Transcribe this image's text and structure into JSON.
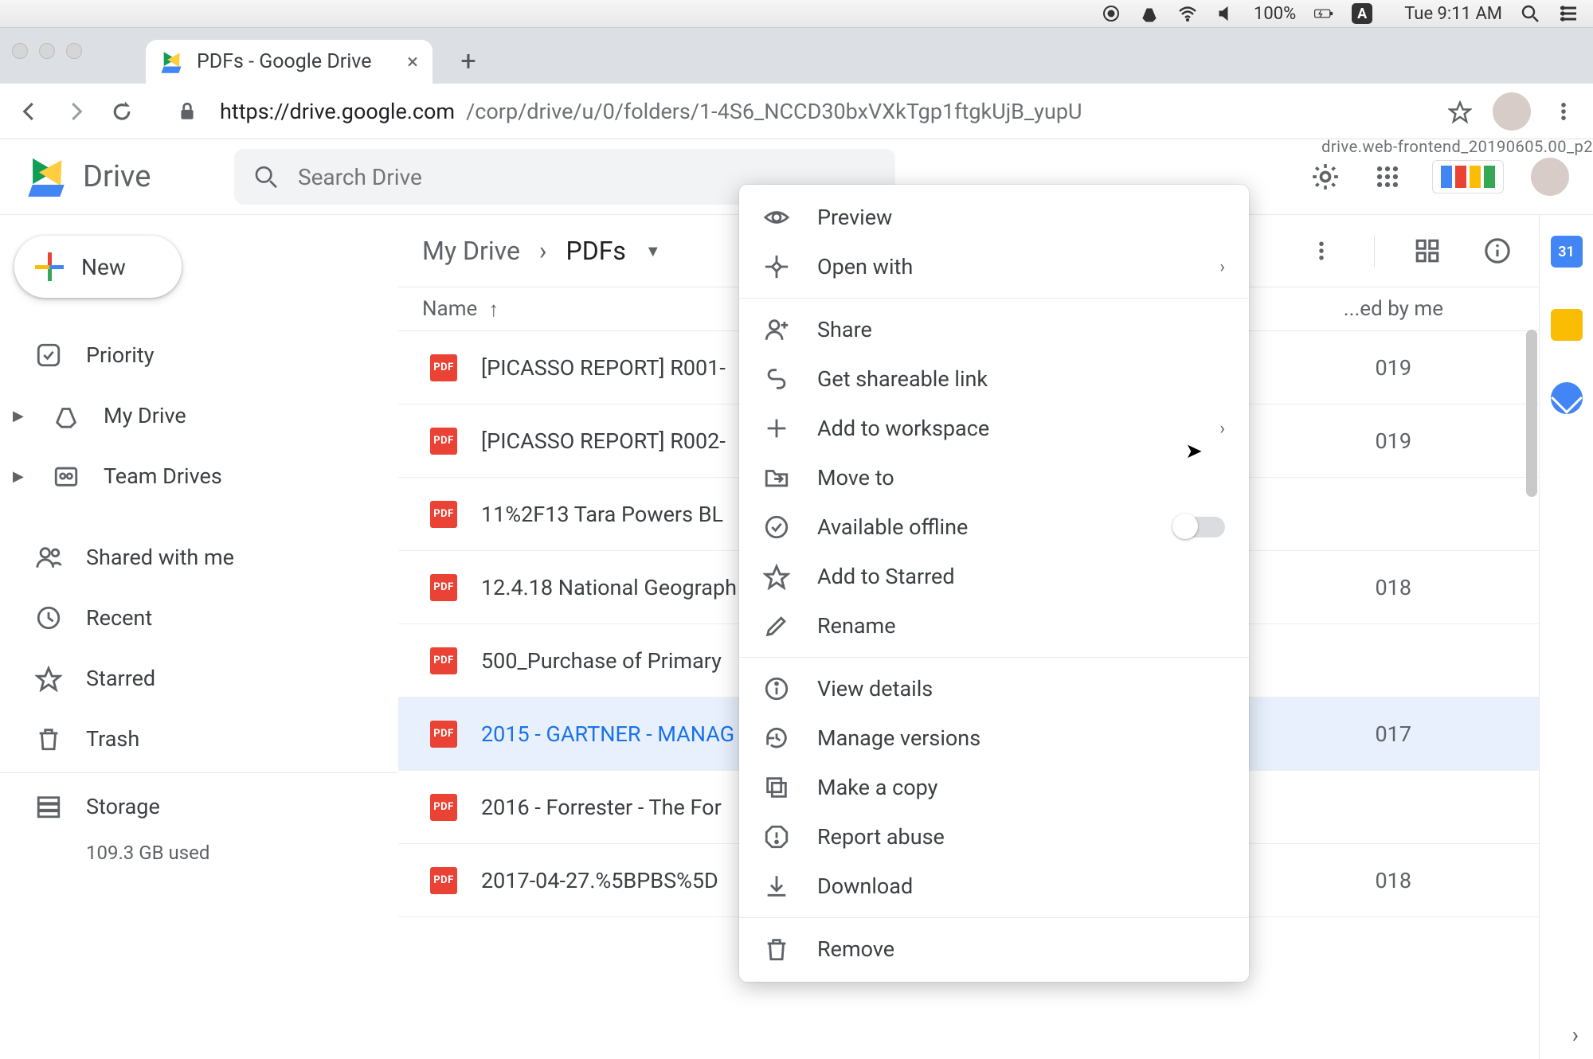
{
  "menubar": {
    "battery": "100%",
    "clock": "Tue 9:11 AM"
  },
  "tab": {
    "title": "PDFs - Google Drive"
  },
  "url": {
    "host": "https://drive.google.com",
    "path": "/corp/drive/u/0/folders/1-4S6_NCCD30bxVXkTgp1ftgkUjB_yupU"
  },
  "frontend_tag": "drive.web-frontend_20190605.00_p2",
  "drive": {
    "product": "Drive",
    "search_placeholder": "Search Drive"
  },
  "newbtn": "New",
  "sidebar": {
    "priority": "Priority",
    "mydrive": "My Drive",
    "teamdrives": "Team Drives",
    "shared": "Shared with me",
    "recent": "Recent",
    "starred": "Starred",
    "trash": "Trash",
    "storage": "Storage",
    "storage_used": "109.3 GB used"
  },
  "breadcrumb": {
    "root": "My Drive",
    "current": "PDFs"
  },
  "columns": {
    "name": "Name",
    "modified": "...ed by me"
  },
  "files": [
    {
      "name": "[PICASSO REPORT] R001-",
      "date": "019"
    },
    {
      "name": "[PICASSO REPORT] R002-",
      "date": "019"
    },
    {
      "name": "11%2F13 Tara Powers BL",
      "date": ""
    },
    {
      "name": "12.4.18 National Geograph",
      "date": "018"
    },
    {
      "name": "500_Purchase of Primary",
      "date": ""
    },
    {
      "name": "2015 - GARTNER - MANAG",
      "date": "017"
    },
    {
      "name": "2016 - Forrester - The For",
      "date": ""
    },
    {
      "name": "2017-04-27.%5BPBS%5D",
      "date": "018"
    }
  ],
  "context": {
    "preview": "Preview",
    "openwith": "Open with",
    "share": "Share",
    "getlink": "Get shareable link",
    "addworkspace": "Add to workspace",
    "moveto": "Move to",
    "offline": "Available offline",
    "star": "Add to Starred",
    "rename": "Rename",
    "details": "View details",
    "versions": "Manage versions",
    "copy": "Make a copy",
    "report": "Report abuse",
    "download": "Download",
    "remove": "Remove"
  }
}
